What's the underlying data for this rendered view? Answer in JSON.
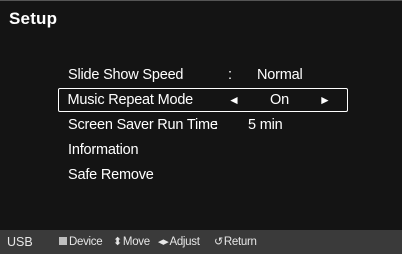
{
  "title": "Setup",
  "menu": {
    "items": [
      {
        "label": "Slide Show Speed",
        "separator": ":",
        "value": "Normal"
      },
      {
        "label": "Music Repeat Mode",
        "value": "On",
        "left_arrow": "◄",
        "right_arrow": "►"
      },
      {
        "label": "Screen Saver Run Time",
        "separator": ":",
        "value": "5 min"
      },
      {
        "label": "Information"
      },
      {
        "label": "Safe Remove"
      }
    ]
  },
  "footer": {
    "source": "USB",
    "hints": [
      {
        "icon": "square-icon",
        "label": "Device"
      },
      {
        "icon": "up-down-arrows-icon",
        "glyph": "⬍",
        "label": "Move"
      },
      {
        "icon": "left-right-arrows-icon",
        "glyph": "◂▸",
        "label": "Adjust"
      },
      {
        "icon": "return-icon",
        "glyph": "↺",
        "label": "Return"
      }
    ]
  }
}
